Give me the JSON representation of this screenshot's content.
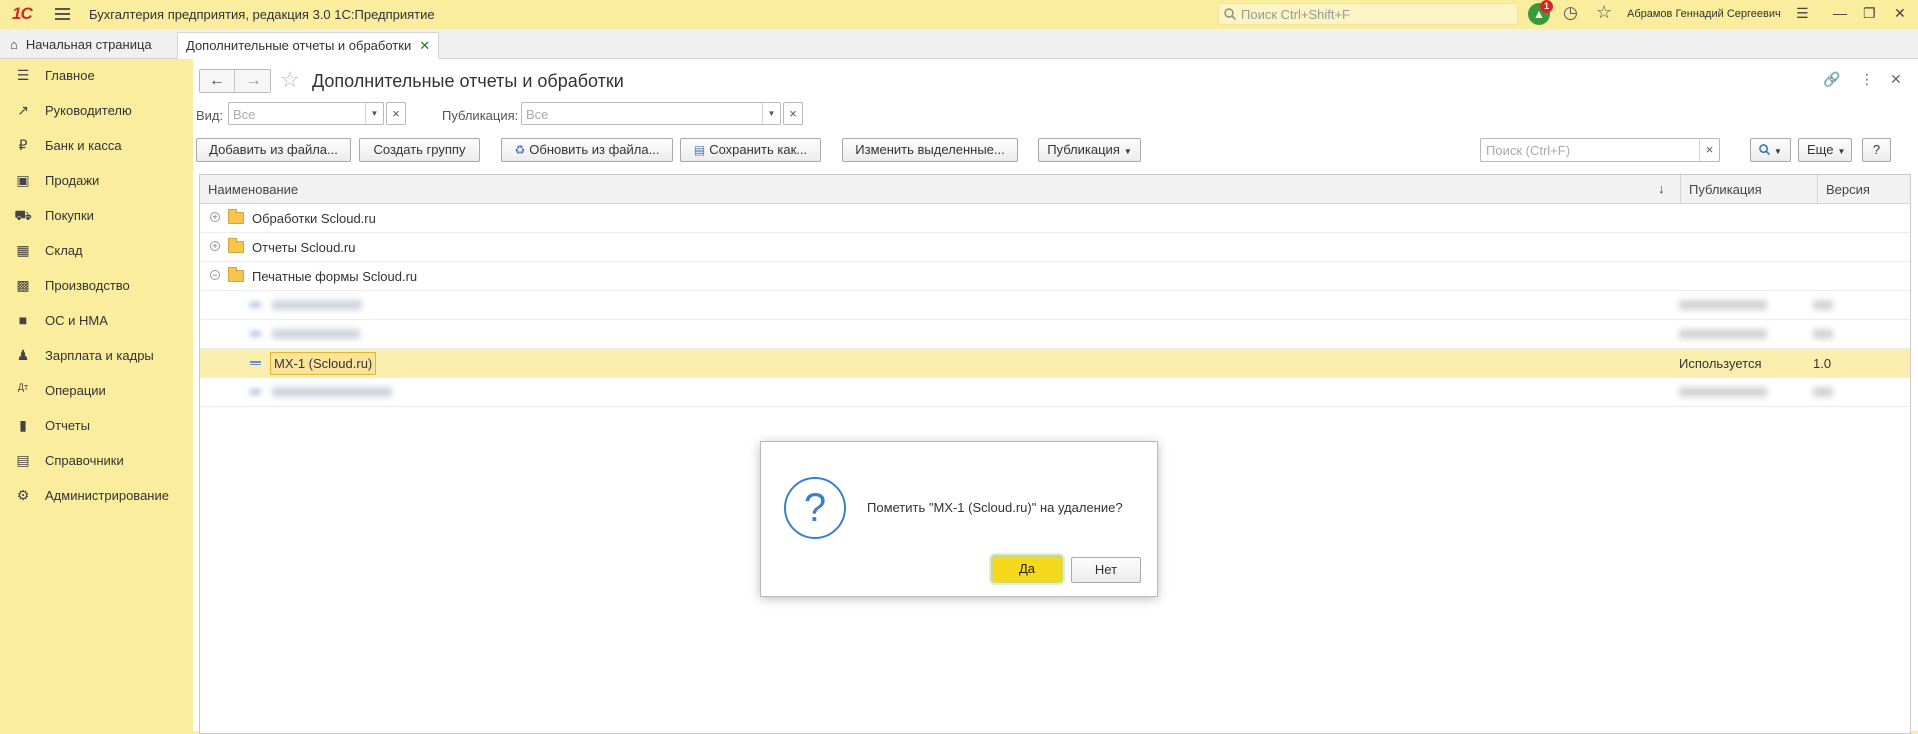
{
  "titlebar": {
    "logo": "1С",
    "title": "Бухгалтерия предприятия, редакция 3.0 1С:Предприятие",
    "search_placeholder": "Поиск Ctrl+Shift+F",
    "notification_count": "1",
    "user": "Абрамов Геннадий Сергеевич"
  },
  "tabs": {
    "home": "Начальная страница",
    "active": "Дополнительные отчеты и обработки"
  },
  "sidebar": {
    "items": [
      {
        "label": "Главное",
        "icon": "list-icon"
      },
      {
        "label": "Руководителю",
        "icon": "trend-icon"
      },
      {
        "label": "Банк и касса",
        "icon": "ruble-icon"
      },
      {
        "label": "Продажи",
        "icon": "bag-icon"
      },
      {
        "label": "Покупки",
        "icon": "cart-icon"
      },
      {
        "label": "Склад",
        "icon": "grid-icon"
      },
      {
        "label": "Производство",
        "icon": "factory-icon"
      },
      {
        "label": "ОС и НМА",
        "icon": "truck-icon"
      },
      {
        "label": "Зарплата и кадры",
        "icon": "person-icon"
      },
      {
        "label": "Операции",
        "icon": "dt-kt-icon"
      },
      {
        "label": "Отчеты",
        "icon": "bar-chart-icon"
      },
      {
        "label": "Справочники",
        "icon": "book-icon"
      },
      {
        "label": "Администрирование",
        "icon": "gear-icon"
      }
    ]
  },
  "page": {
    "title": "Дополнительные отчеты и обработки"
  },
  "filters": {
    "vid_label": "Вид:",
    "vid_placeholder": "Все",
    "pub_label": "Публикация:",
    "pub_placeholder": "Все"
  },
  "toolbar": {
    "add_from_file": "Добавить из файла...",
    "create_group": "Создать группу",
    "update_from_file": "Обновить из файла...",
    "save_as": "Сохранить как...",
    "change_selected": "Изменить выделенные...",
    "publication": "Публикация",
    "search_placeholder": "Поиск (Ctrl+F)",
    "more": "Еще",
    "help": "?"
  },
  "table": {
    "columns": [
      "Наименование",
      "Публикация",
      "Версия"
    ],
    "groups": [
      {
        "name": "Обработки Scloud.ru",
        "expanded": false
      },
      {
        "name": "Отчеты Scloud.ru",
        "expanded": false
      },
      {
        "name": "Печатные формы Scloud.ru",
        "expanded": true
      }
    ],
    "selected_row": {
      "name": "МХ-1 (Scloud.ru)",
      "publication": "Используется",
      "version": "1.0"
    }
  },
  "dialog": {
    "message": "Пометить \"МХ-1 (Scloud.ru)\" на удаление?",
    "yes": "Да",
    "no": "Нет"
  }
}
